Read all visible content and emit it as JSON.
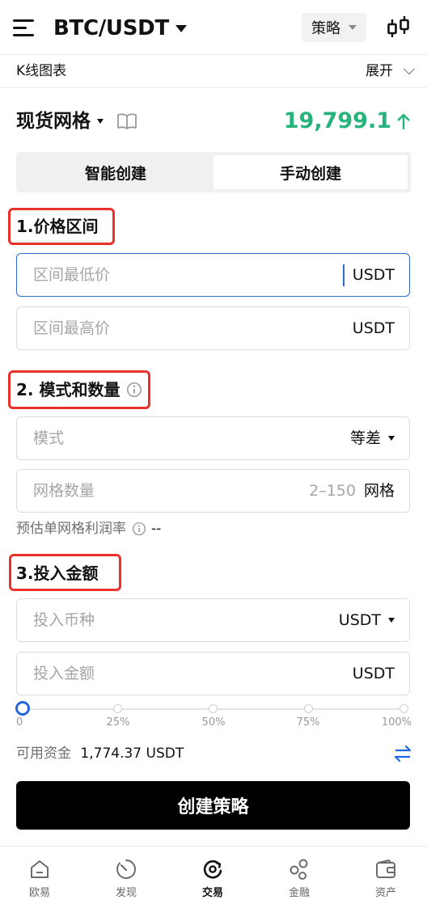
{
  "header": {
    "pair": "BTC/USDT",
    "strategy_button": "策略"
  },
  "kline": {
    "label": "K线图表",
    "expand_label": "展开"
  },
  "title_row": {
    "title": "现货网格",
    "price": "19,799.1",
    "price_color": "#27b37c"
  },
  "tabs": [
    {
      "label": "智能创建",
      "selected": false
    },
    {
      "label": "手动创建",
      "selected": true
    }
  ],
  "section1": {
    "title": "1.价格区间",
    "low_placeholder": "区间最低价",
    "low_unit": "USDT",
    "high_placeholder": "区间最高价",
    "high_unit": "USDT"
  },
  "section2": {
    "title": "2. 模式和数量",
    "mode_placeholder": "模式",
    "mode_value": "等差",
    "grid_placeholder": "网格数量",
    "grid_range": "2–150",
    "grid_unit": "网格",
    "profit_label": "预估单网格利润率",
    "profit_value": "--"
  },
  "section3": {
    "title": "3.投入金额",
    "coin_placeholder": "投入币种",
    "coin_value": "USDT",
    "amount_placeholder": "投入金额",
    "amount_unit": "USDT",
    "slider_ticks": [
      "0",
      "25%",
      "50%",
      "75%",
      "100%"
    ],
    "slider_value_percent": 0
  },
  "available": {
    "label": "可用资金",
    "value": "1,774.37 USDT"
  },
  "create_button": "创建策略",
  "accent_colors": {
    "highlight_box": "#e8312a",
    "active_blue": "#2466e0"
  },
  "bottom_nav": [
    {
      "label": "欧易",
      "icon": "home-icon",
      "active": false
    },
    {
      "label": "发现",
      "icon": "discover-icon",
      "active": false
    },
    {
      "label": "交易",
      "icon": "trade-icon",
      "active": true
    },
    {
      "label": "金融",
      "icon": "finance-icon",
      "active": false
    },
    {
      "label": "资产",
      "icon": "wallet-icon",
      "active": false
    }
  ]
}
